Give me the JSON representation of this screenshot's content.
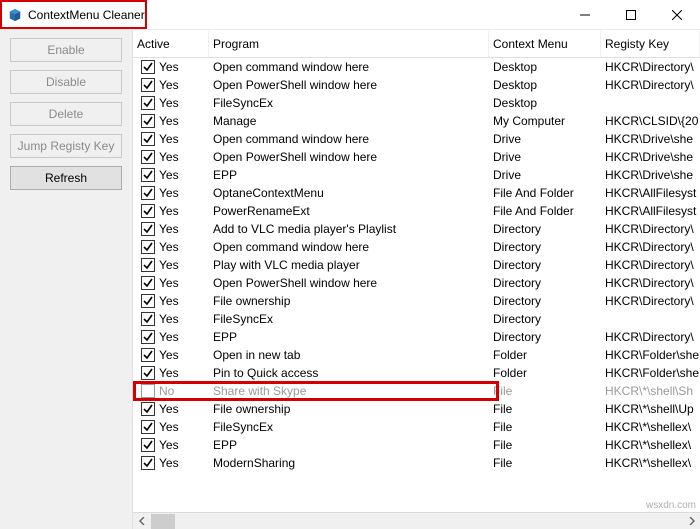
{
  "window": {
    "title": "ContextMenu Cleaner"
  },
  "sidebar": {
    "enable": "Enable",
    "disable": "Disable",
    "delete": "Delete",
    "jump": "Jump Registy Key",
    "refresh": "Refresh"
  },
  "columns": {
    "active": "Active",
    "program": "Program",
    "context": "Context Menu",
    "regkey": "Registy Key"
  },
  "rows": [
    {
      "checked": true,
      "active": "Yes",
      "program": "Open command window here",
      "context": "Desktop",
      "regkey": "HKCR\\Directory\\"
    },
    {
      "checked": true,
      "active": "Yes",
      "program": "Open PowerShell window here",
      "context": "Desktop",
      "regkey": "HKCR\\Directory\\"
    },
    {
      "checked": true,
      "active": "Yes",
      "program": " FileSyncEx",
      "context": "Desktop",
      "regkey": ""
    },
    {
      "checked": true,
      "active": "Yes",
      "program": "Manage",
      "context": "My Computer",
      "regkey": "HKCR\\CLSID\\{20"
    },
    {
      "checked": true,
      "active": "Yes",
      "program": "Open command window here",
      "context": "Drive",
      "regkey": "HKCR\\Drive\\she"
    },
    {
      "checked": true,
      "active": "Yes",
      "program": "Open PowerShell window here",
      "context": "Drive",
      "regkey": "HKCR\\Drive\\she"
    },
    {
      "checked": true,
      "active": "Yes",
      "program": "EPP",
      "context": "Drive",
      "regkey": "HKCR\\Drive\\she"
    },
    {
      "checked": true,
      "active": "Yes",
      "program": "OptaneContextMenu",
      "context": "File And Folder",
      "regkey": "HKCR\\AllFilesyst"
    },
    {
      "checked": true,
      "active": "Yes",
      "program": "PowerRenameExt",
      "context": "File And Folder",
      "regkey": "HKCR\\AllFilesyst"
    },
    {
      "checked": true,
      "active": "Yes",
      "program": "Add to VLC media player's Playlist",
      "context": "Directory",
      "regkey": "HKCR\\Directory\\"
    },
    {
      "checked": true,
      "active": "Yes",
      "program": "Open command window here",
      "context": "Directory",
      "regkey": "HKCR\\Directory\\"
    },
    {
      "checked": true,
      "active": "Yes",
      "program": "Play with VLC media player",
      "context": "Directory",
      "regkey": "HKCR\\Directory\\"
    },
    {
      "checked": true,
      "active": "Yes",
      "program": "Open PowerShell window here",
      "context": "Directory",
      "regkey": "HKCR\\Directory\\"
    },
    {
      "checked": true,
      "active": "Yes",
      "program": "File ownership",
      "context": "Directory",
      "regkey": "HKCR\\Directory\\"
    },
    {
      "checked": true,
      "active": "Yes",
      "program": " FileSyncEx",
      "context": "Directory",
      "regkey": ""
    },
    {
      "checked": true,
      "active": "Yes",
      "program": "EPP",
      "context": "Directory",
      "regkey": "HKCR\\Directory\\"
    },
    {
      "checked": true,
      "active": "Yes",
      "program": "Open in new tab",
      "context": "Folder",
      "regkey": "HKCR\\Folder\\she"
    },
    {
      "checked": true,
      "active": "Yes",
      "program": "Pin to Quick access",
      "context": "Folder",
      "regkey": "HKCR\\Folder\\she"
    },
    {
      "checked": false,
      "active": "No",
      "program": "Share with Skype",
      "context": "File",
      "regkey": "HKCR\\*\\shell\\Sh",
      "disabled": true,
      "highlight": true
    },
    {
      "checked": true,
      "active": "Yes",
      "program": "File ownership",
      "context": "File",
      "regkey": "HKCR\\*\\shell\\Up"
    },
    {
      "checked": true,
      "active": "Yes",
      "program": " FileSyncEx",
      "context": "File",
      "regkey": "HKCR\\*\\shellex\\"
    },
    {
      "checked": true,
      "active": "Yes",
      "program": "EPP",
      "context": "File",
      "regkey": "HKCR\\*\\shellex\\"
    },
    {
      "checked": true,
      "active": "Yes",
      "program": "ModernSharing",
      "context": "File",
      "regkey": "HKCR\\*\\shellex\\"
    }
  ],
  "watermark": "wsxdn.com"
}
